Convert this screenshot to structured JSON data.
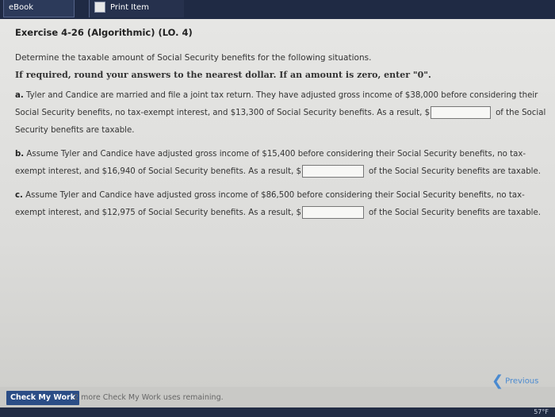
{
  "tabs": {
    "ebook": "eBook",
    "print": "Print Item"
  },
  "exercise": {
    "title": "Exercise 4-26 (Algorithmic) (LO. 4)",
    "prompt": "Determine the taxable amount of Social Security benefits for the following situations.",
    "instruction": "If required, round your answers to the nearest dollar. If an amount is zero, enter \"0\"."
  },
  "items": {
    "a": {
      "label": "a.",
      "text1": "Tyler and Candice are married and file a joint tax return. They have adjusted gross income of $38,000 before considering their Social Security benefits, no tax-exempt interest, and $13,300 of Social Security benefits. As a result, $",
      "text2": "of the Social Security benefits are taxable.",
      "value": ""
    },
    "b": {
      "label": "b.",
      "text1": "Assume Tyler and Candice have adjusted gross income of $15,400 before considering their Social Security benefits, no tax-exempt interest, and $16,940 of Social Security benefits. As a result, $",
      "text2": "of the Social Security benefits are taxable.",
      "value": ""
    },
    "c": {
      "label": "c.",
      "text1": "Assume Tyler and Candice have adjusted gross income of $86,500 before considering their Social Security benefits, no tax-exempt interest, and $12,975 of Social Security benefits. As a result, $",
      "text2": "of the Social Security benefits are taxable.",
      "value": ""
    }
  },
  "footer": {
    "check_label": "Check My Work",
    "remaining": "2 more Check My Work uses remaining.",
    "previous": "Previous"
  },
  "taskbar": {
    "temp": "57°F"
  },
  "colors": {
    "topbar": "#1f2a44",
    "check_button": "#2b4d86",
    "previous": "#4a8ad0"
  }
}
